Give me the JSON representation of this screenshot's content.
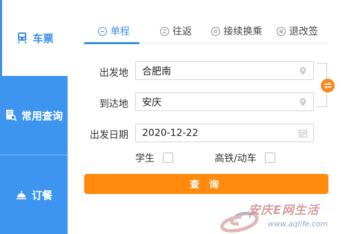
{
  "sidebar": {
    "items": [
      {
        "label": "车票",
        "icon": "train-icon"
      },
      {
        "label": "常用查询",
        "icon": "search-document-icon"
      },
      {
        "label": "订餐",
        "icon": "meal-bell-icon"
      }
    ]
  },
  "tabs": [
    {
      "label": "单程",
      "icon": "minus-circle-icon"
    },
    {
      "label": "往返",
      "icon": "double-line-circle-icon"
    },
    {
      "label": "接续换乘",
      "icon": "transfer-circle-icon"
    },
    {
      "label": "退改签",
      "icon": "list-circle-icon"
    }
  ],
  "form": {
    "from_label": "出发地",
    "from_value": "合肥南",
    "to_label": "到达地",
    "to_value": "安庆",
    "date_label": "出发日期",
    "date_value": "2020-12-22",
    "student_label": "学生",
    "student_checked": false,
    "highspeed_label": "高铁/动车",
    "highspeed_checked": false
  },
  "actions": {
    "query_label": "查询"
  },
  "watermark": {
    "text": "安庆E网生活",
    "url": "www.aqlife.com"
  },
  "colors": {
    "accent": "#3a8ee6",
    "sidebar_blue": "#3d95f0",
    "orange": "#ff8a0d"
  }
}
